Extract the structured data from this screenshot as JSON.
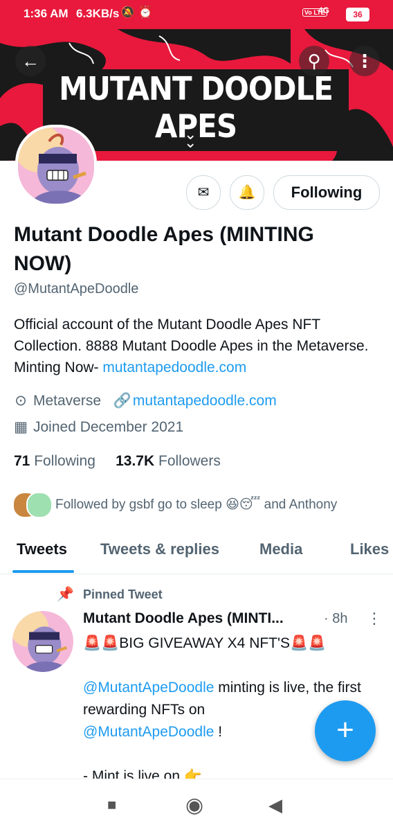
{
  "status_bar": {
    "time": "1:36 AM",
    "speed": "6.3KB/s",
    "icons": "🔕 ⏰",
    "volte": "Vo LTE",
    "network": "4G",
    "battery": "36"
  },
  "banner": {
    "title": "MUTANT DOODLE APES",
    "accent_color": "#e8193c"
  },
  "header_buttons": {
    "back_icon": "←",
    "search_icon": "⚲",
    "more_icon": "⋮"
  },
  "profile": {
    "message_icon": "✉",
    "notify_icon": "🔔",
    "following_label": "Following",
    "display_name": "Mutant Doodle Apes (MINTING NOW)",
    "handle": "@MutantApeDoodle",
    "bio_text": "Official account of the Mutant Doodle Apes NFT Collection.  8888 Mutant Doodle Apes in the Metaverse. Minting Now- ",
    "bio_link": "mutantapedoodle.com",
    "location_icon": "⊙",
    "location": "Metaverse",
    "link_icon": "🔗",
    "website": "mutantapedoodle.com",
    "calendar_icon": "▦",
    "joined": "Joined December 2021",
    "following_count": "71",
    "followers_count": "13.7K",
    "followers_label": "Followers",
    "followed_by": "Followed by gsbf go to sleep 😆😴 and Anthony"
  },
  "tabs": [
    "Tweets",
    "Tweets & replies",
    "Media",
    "Likes"
  ],
  "tweet": {
    "pin_icon": "📌",
    "pinned_label": "Pinned Tweet",
    "author": "Mutant Doodle Apes (MINTI...",
    "time": "· 8h",
    "more": "⋮",
    "line1": "🚨🚨BIG GIVEAWAY X4 NFT'S🚨🚨",
    "mention1": "@MutantApeDoodle",
    "line2_rest": " minting is live, the first rewarding NFTs on",
    "mention2": "@MutantApeDoodle",
    "line3_rest": " !",
    "line4": "- Mint is live on 👉"
  },
  "fab": {
    "label": "+"
  },
  "nav": {
    "recents": "■",
    "home": "◉",
    "back": "◀"
  }
}
